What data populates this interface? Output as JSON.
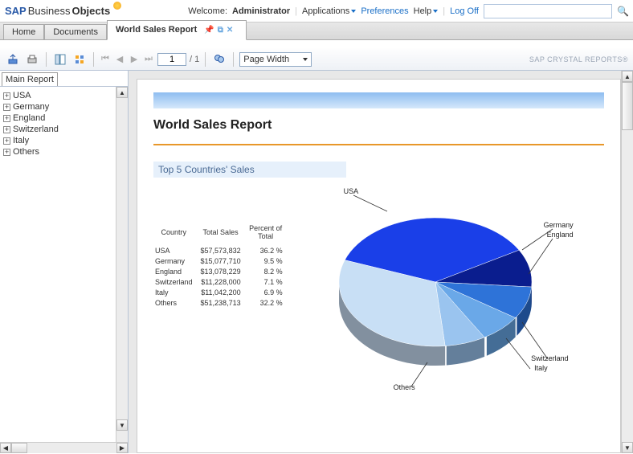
{
  "header": {
    "logo_sap": "SAP",
    "logo_business": "Business",
    "logo_objects": "Objects",
    "welcome_prefix": "Welcome:",
    "welcome_user": "Administrator",
    "applications": "Applications",
    "preferences": "Preferences",
    "help": "Help",
    "logoff": "Log Off"
  },
  "tabs": {
    "home": "Home",
    "documents": "Documents",
    "report": "World Sales Report"
  },
  "toolbar": {
    "page_current": "1",
    "page_sep": "/ 1",
    "zoom": "Page Width",
    "brand": "SAP CRYSTAL REPORTS®"
  },
  "sidebar": {
    "tab": "Main Report",
    "items": [
      {
        "label": "USA"
      },
      {
        "label": "Germany"
      },
      {
        "label": "England"
      },
      {
        "label": "Switzerland"
      },
      {
        "label": "Italy"
      },
      {
        "label": "Others"
      }
    ]
  },
  "report": {
    "title": "World Sales Report",
    "subtitle": "Top 5 Countries' Sales",
    "table_headers": {
      "c1": "Country",
      "c2": "Total Sales",
      "c3": "Percent of Total"
    },
    "rows": [
      {
        "country": "USA",
        "sales": "$57,573,832",
        "pct": "36.2  %"
      },
      {
        "country": "Germany",
        "sales": "$15,077,710",
        "pct": "9.5  %"
      },
      {
        "country": "England",
        "sales": "$13,078,229",
        "pct": "8.2  %"
      },
      {
        "country": "Switzerland",
        "sales": "$11,228,000",
        "pct": "7.1  %"
      },
      {
        "country": "Italy",
        "sales": "$11,042,200",
        "pct": "6.9  %"
      },
      {
        "country": "Others",
        "sales": "$51,238,713",
        "pct": "32.2  %"
      }
    ]
  },
  "chart_data": {
    "type": "pie",
    "title": "Top 5 Countries' Sales",
    "series": [
      {
        "name": "USA",
        "value": 36.2,
        "color": "#1a3fe8"
      },
      {
        "name": "Germany",
        "value": 9.5,
        "color": "#0a1d8e"
      },
      {
        "name": "England",
        "value": 8.2,
        "color": "#2e73d8"
      },
      {
        "name": "Switzerland",
        "value": 7.1,
        "color": "#6aa8e8"
      },
      {
        "name": "Italy",
        "value": 6.9,
        "color": "#9ac4ef"
      },
      {
        "name": "Others",
        "value": 32.2,
        "color": "#c8dff5"
      }
    ]
  }
}
